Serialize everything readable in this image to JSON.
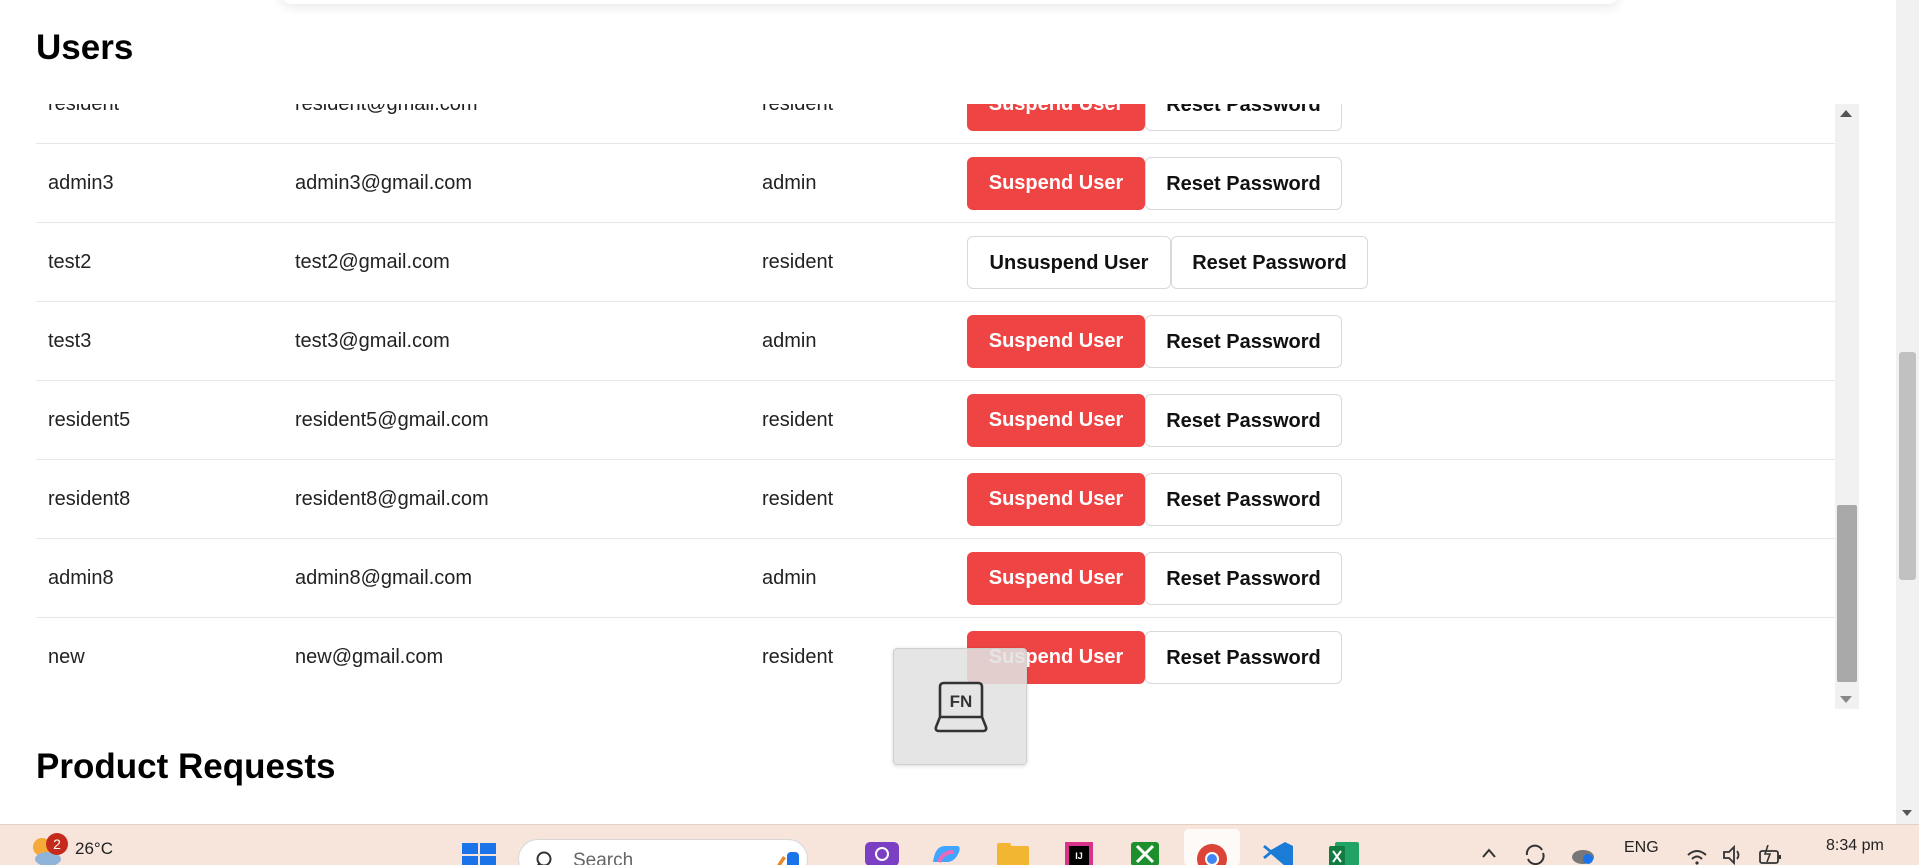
{
  "users_section": {
    "title": "Users",
    "rows": [
      {
        "username": "resident",
        "email": "resident@gmail.com",
        "role": "resident",
        "suspend_label": "Suspend User",
        "reset_label": "Reset Password"
      },
      {
        "username": "admin3",
        "email": "admin3@gmail.com",
        "role": "admin",
        "suspend_label": "Suspend User",
        "reset_label": "Reset Password"
      },
      {
        "username": "test2",
        "email": "test2@gmail.com",
        "role": "resident",
        "unsuspend_label": "Unsuspend User",
        "reset_label": "Reset Password"
      },
      {
        "username": "test3",
        "email": "test3@gmail.com",
        "role": "admin",
        "suspend_label": "Suspend User",
        "reset_label": "Reset Password"
      },
      {
        "username": "resident5",
        "email": "resident5@gmail.com",
        "role": "resident",
        "suspend_label": "Suspend User",
        "reset_label": "Reset Password"
      },
      {
        "username": "resident8",
        "email": "resident8@gmail.com",
        "role": "resident",
        "suspend_label": "Suspend User",
        "reset_label": "Reset Password"
      },
      {
        "username": "admin8",
        "email": "admin8@gmail.com",
        "role": "admin",
        "suspend_label": "Suspend User",
        "reset_label": "Reset Password"
      },
      {
        "username": "new",
        "email": "new@gmail.com",
        "role": "resident",
        "suspend_label": "Suspend User",
        "reset_label": "Reset Password"
      }
    ]
  },
  "product_requests_section": {
    "title": "Product Requests"
  },
  "fn_overlay": {
    "key_label": "FN"
  },
  "taskbar": {
    "weather_badge": "2",
    "weather_temp": "26°C",
    "search_placeholder": "Search",
    "language": "ENG",
    "time": "8:34 pm",
    "apps": [
      "start-icon",
      "copilot-icon",
      "file-explorer-icon",
      "intellij-icon",
      "xbox-icon",
      "chrome-icon",
      "vscode-icon",
      "excel-icon"
    ]
  },
  "colors": {
    "suspend_button": "#ef4444",
    "taskbar_background": "#f7e5dc"
  }
}
